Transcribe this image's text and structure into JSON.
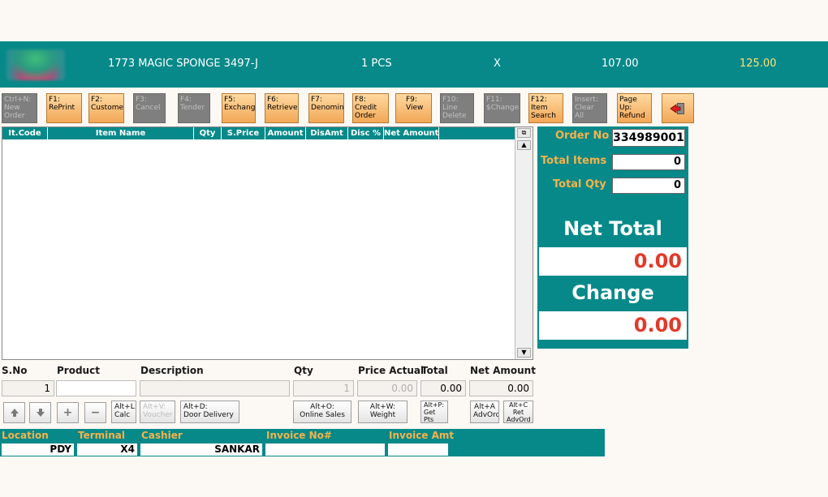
{
  "topbar": {
    "item": "1773 MAGIC SPONGE 3497-J",
    "qty": "1 PCS",
    "x": "X",
    "price": "107.00",
    "total": "125.00"
  },
  "toolbar": [
    {
      "label": "Ctrl+N:\nNew\nOrder",
      "enabled": false
    },
    {
      "label": "F1:\nRePrint",
      "enabled": true
    },
    {
      "label": "F2:\nCustome",
      "enabled": true
    },
    {
      "label": "F3:\nCancel",
      "enabled": false
    },
    {
      "label": "F4:\nTender",
      "enabled": false
    },
    {
      "label": "F5:\nExchang",
      "enabled": true
    },
    {
      "label": "F6:\nRetrieve",
      "enabled": true
    },
    {
      "label": "F7:\nDenomin",
      "enabled": true
    },
    {
      "label": "F8:\nCredit\nOrder",
      "enabled": true
    },
    {
      "label": "F9:\nView",
      "enabled": true
    },
    {
      "label": "F10:\nLine\nDelete",
      "enabled": false
    },
    {
      "label": "F11:\n$Change",
      "enabled": false
    },
    {
      "label": "F12:\nItem\nSearch",
      "enabled": true
    },
    {
      "label": "Insert:\nClear All",
      "enabled": false
    },
    {
      "label": "Page\nUp:\nRefund",
      "enabled": true
    }
  ],
  "grid": {
    "columns": [
      "It.Code",
      "Item Name",
      "Qty",
      "S.Price",
      "Amount",
      "DisAmt",
      "Disc %",
      "Net Amount"
    ],
    "rows": []
  },
  "summary": {
    "order_no_label": "Order No",
    "order_no": "334989001",
    "total_items_label": "Total Items",
    "total_items": "0",
    "total_qty_label": "Total Qty",
    "total_qty": "0",
    "net_total_label": "Net Total",
    "net_total": "0.00",
    "change_label": "Change",
    "change": "0.00"
  },
  "entry": {
    "sno_label": "S.No",
    "product_label": "Product",
    "description_label": "Description",
    "qty_label": "Qty",
    "price_label": "Price Actual",
    "total_label": "Total",
    "net_label": "Net Amount",
    "sno": "1",
    "product": "",
    "description": "",
    "qty": "1",
    "price": "0.00",
    "total": "0.00",
    "net": "0.00"
  },
  "actions": {
    "calc": "Alt+L:\nCalc",
    "voucher": "Alt+V:\nVoucher",
    "door": "Alt+D:\nDoor Delivery",
    "online": "Alt+O:\nOnline Sales",
    "weight": "Alt+W:\nWeight",
    "points": "Alt+P:\nGet\nPts",
    "advord": "Alt+A\nAdvOrd",
    "retadv": "Alt+C\nRet\nAdvOrd"
  },
  "footer": {
    "location_label": "Location",
    "terminal_label": "Terminal",
    "cashier_label": "Cashier",
    "invoice_label": "Invoice No#",
    "invamt_label": "Invoice Amt",
    "location": "PDY",
    "terminal": "X4",
    "cashier": "SANKAR",
    "invoice": "",
    "invamt": ""
  },
  "colors": {
    "teal": "#078989",
    "orange_label": "#f5b24a",
    "red_value": "#e23a2a",
    "button_orange": "#f2a757"
  }
}
